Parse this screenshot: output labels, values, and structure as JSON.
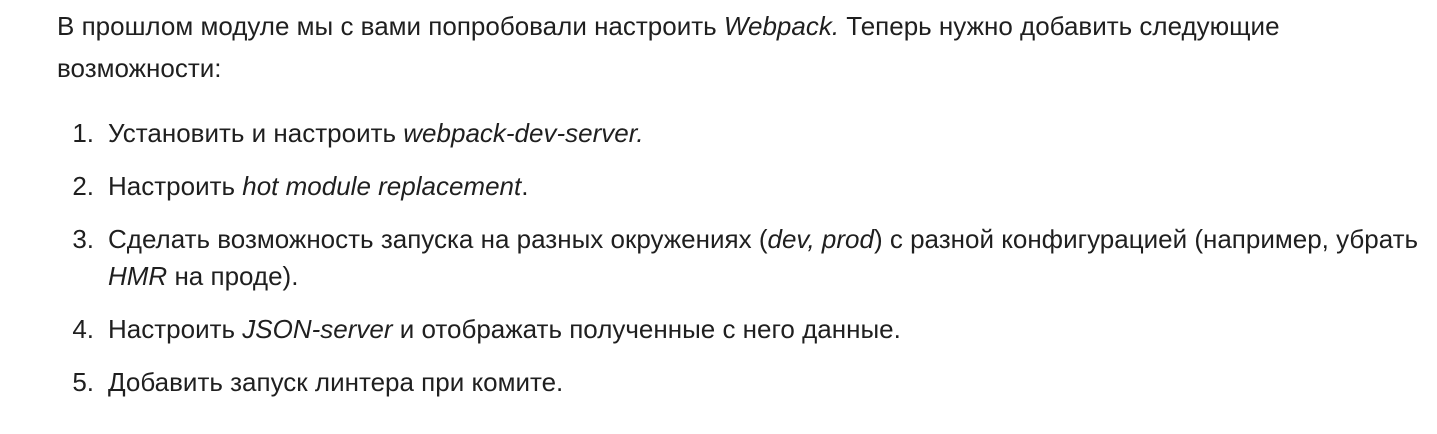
{
  "intro": {
    "before": "В прошлом модуле мы с вами попробовали настроить ",
    "emphasis": "Webpack.",
    "after": " Теперь нужно добавить следующие возможности:"
  },
  "tasks": [
    {
      "number": "1.",
      "parts": [
        "Установить и настроить ",
        "webpack-dev-server.",
        ""
      ]
    },
    {
      "number": "2.",
      "parts": [
        "Настроить ",
        "hot module replacement",
        "."
      ]
    },
    {
      "number": "3.",
      "parts": [
        "Сделать возможность запуска на разных окружениях (",
        "dev, prod",
        ") с разной конфигурацией (например, убрать ",
        "HMR",
        " на проде)."
      ]
    },
    {
      "number": "4.",
      "parts": [
        "Настроить ",
        "JSON-server",
        " и отображать полученные с него данные."
      ]
    },
    {
      "number": "5.",
      "parts": [
        "Добавить запуск линтера при комите."
      ]
    }
  ]
}
